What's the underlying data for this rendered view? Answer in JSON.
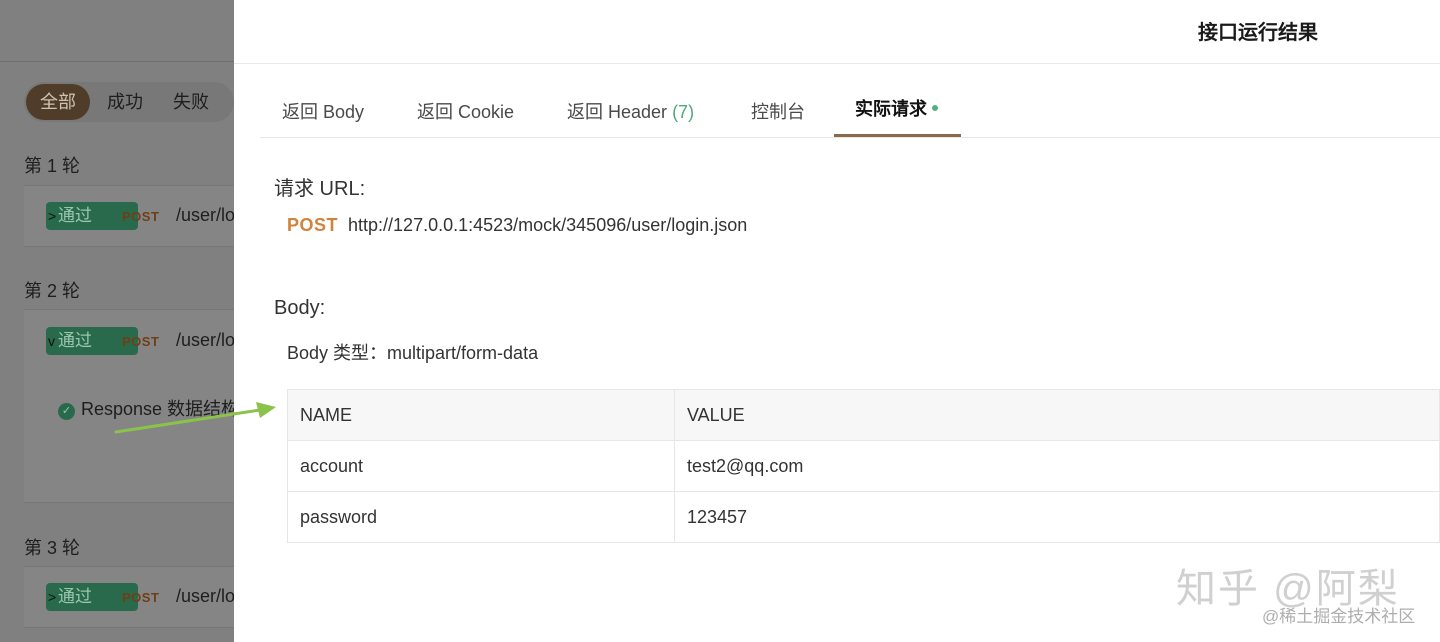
{
  "filter": {
    "all": "全部",
    "success": "成功",
    "fail": "失败"
  },
  "rounds": [
    {
      "label": "第 1 轮",
      "status": "通过",
      "method": "POST",
      "path": "/user/login.json"
    },
    {
      "label": "第 2 轮",
      "status": "通过",
      "method": "POST",
      "path": "/user/login.json",
      "assertion": "Response 数据结构校验"
    },
    {
      "label": "第 3 轮",
      "status": "通过",
      "method": "POST",
      "path": "/user/login.json"
    }
  ],
  "drawer": {
    "title": "接口运行结果",
    "tabs": [
      {
        "label": "返回 Body"
      },
      {
        "label": "返回 Cookie"
      },
      {
        "label": "返回 Header",
        "count": "(7)"
      },
      {
        "label": "控制台"
      },
      {
        "label": "实际请求"
      }
    ],
    "request_url_label": "请求 URL:",
    "method": "POST",
    "url": "http://127.0.0.1:4523/mock/345096/user/login.json",
    "body_label": "Body:",
    "body_type": "Body 类型：multipart/form-data",
    "table": {
      "headers": [
        "NAME",
        "VALUE"
      ],
      "rows": [
        [
          "account",
          "test2@qq.com"
        ],
        [
          "password",
          "123457"
        ]
      ]
    }
  },
  "watermark": {
    "main": "知乎 @阿梨",
    "sub": "@稀土掘金技术社区"
  },
  "colors": {
    "accent": "#8a6a4a",
    "success": "#4cb37d",
    "post": "#d0833d",
    "arrow": "#8bc34a"
  }
}
